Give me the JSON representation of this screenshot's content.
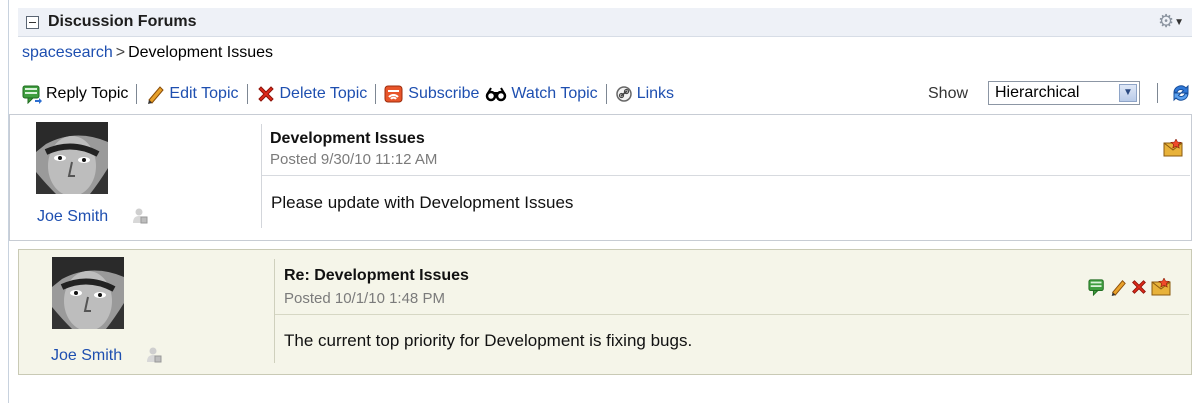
{
  "header": {
    "title": "Discussion Forums"
  },
  "breadcrumb": {
    "root": "spacesearch",
    "separator": ">",
    "current": "Development Issues"
  },
  "toolbar": {
    "reply": "Reply Topic",
    "edit": "Edit Topic",
    "delete": "Delete Topic",
    "subscribe": "Subscribe",
    "watch": "Watch Topic",
    "links": "Links",
    "show_label": "Show",
    "view_mode": "Hierarchical"
  },
  "posts": [
    {
      "author": "Joe Smith",
      "subject": "Development Issues",
      "posted": "Posted 9/30/10 11:12 AM",
      "body": "Please update with Development Issues"
    },
    {
      "author": "Joe Smith",
      "subject": "Re: Development Issues",
      "posted": "Posted 10/1/10 1:48 PM",
      "body": "The current top priority for Development is fixing bugs."
    }
  ],
  "colors": {
    "link": "#1e4fb0",
    "reply_bg": "#f5f5e9",
    "header_bg": "#eef1f7"
  }
}
